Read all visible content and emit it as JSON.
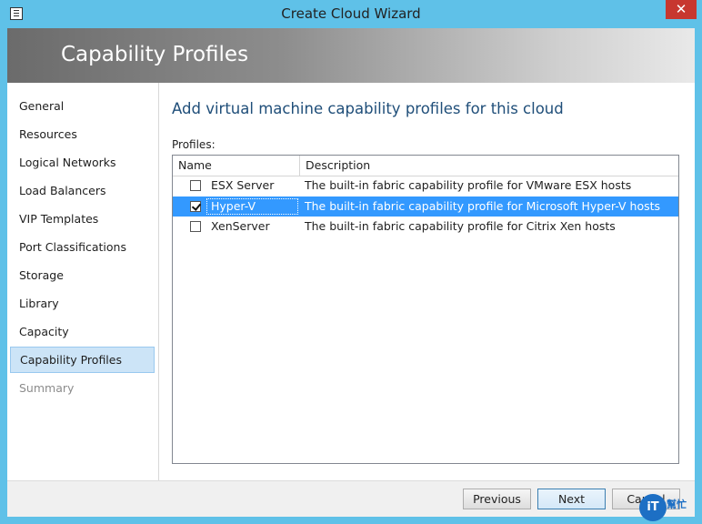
{
  "window": {
    "title": "Create Cloud Wizard",
    "close_glyph": "✕"
  },
  "banner": {
    "title": "Capability Profiles"
  },
  "nav": {
    "items": [
      {
        "label": "General"
      },
      {
        "label": "Resources"
      },
      {
        "label": "Logical Networks"
      },
      {
        "label": "Load Balancers"
      },
      {
        "label": "VIP Templates"
      },
      {
        "label": "Port Classifications"
      },
      {
        "label": "Storage"
      },
      {
        "label": "Library"
      },
      {
        "label": "Capacity"
      },
      {
        "label": "Capability Profiles",
        "state": "active"
      },
      {
        "label": "Summary",
        "state": "disabled"
      }
    ]
  },
  "content": {
    "heading": "Add virtual machine capability profiles for this cloud",
    "profiles_label": "Profiles:",
    "columns": {
      "name": "Name",
      "description": "Description"
    },
    "rows": [
      {
        "name": "ESX Server",
        "description": "The built-in fabric capability profile for VMware ESX hosts",
        "checked": false,
        "selected": false
      },
      {
        "name": "Hyper-V",
        "description": "The built-in fabric capability profile for Microsoft Hyper-V hosts",
        "checked": true,
        "selected": true
      },
      {
        "name": "XenServer",
        "description": "The built-in fabric capability profile for Citrix Xen hosts",
        "checked": false,
        "selected": false
      }
    ]
  },
  "footer": {
    "previous_label": "Previous",
    "next_label": "Next",
    "cancel_label": "Cancel"
  },
  "watermark": {
    "logo_text": "iT",
    "text": "幫忙"
  },
  "colors": {
    "accent": "#3399ff",
    "title_bar": "#5fc1e8",
    "close": "#c7372f",
    "heading": "#1f4e79"
  }
}
